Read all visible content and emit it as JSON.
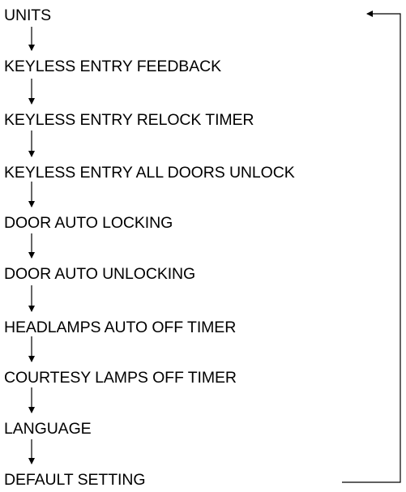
{
  "flow": {
    "items": [
      {
        "label": "UNITS"
      },
      {
        "label": "KEYLESS ENTRY FEEDBACK"
      },
      {
        "label": "KEYLESS ENTRY RELOCK TIMER"
      },
      {
        "label": "KEYLESS ENTRY ALL DOORS UNLOCK"
      },
      {
        "label": "DOOR AUTO LOCKING"
      },
      {
        "label": "DOOR AUTO UNLOCKING"
      },
      {
        "label": "HEADLAMPS AUTO OFF TIMER"
      },
      {
        "label": "COURTESY LAMPS OFF TIMER"
      },
      {
        "label": "LANGUAGE"
      },
      {
        "label": "DEFAULT SETTING"
      }
    ],
    "loop_back": "DEFAULT SETTING returns to UNITS"
  }
}
